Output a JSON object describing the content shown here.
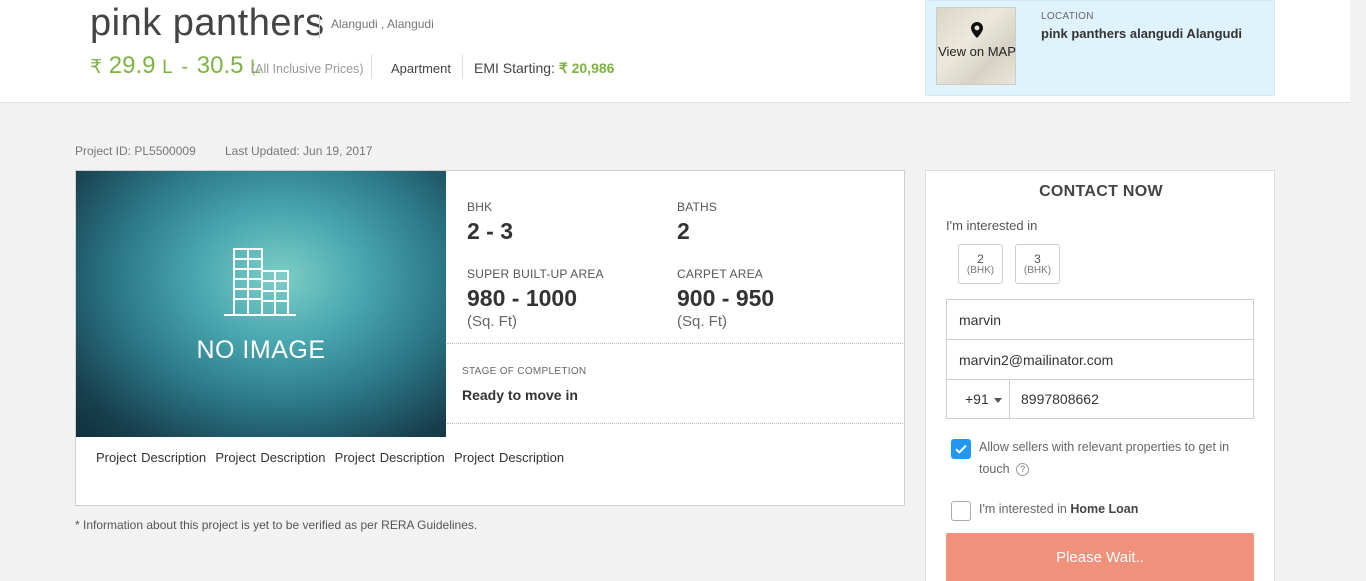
{
  "project": {
    "name": "pink panthers",
    "locality": "Alangudi , Alangudi",
    "price": {
      "currency": "₹",
      "min": "29.9",
      "max": "30.5",
      "unit": "L",
      "separator": "-",
      "note": "(All Inclusive Prices)"
    },
    "property_type": "Apartment",
    "emi": {
      "label": "EMI Starting:",
      "value": "₹ 20,986"
    },
    "id_text": "Project ID: PL5500009",
    "last_updated": "Last Updated: Jun 19, 2017"
  },
  "location": {
    "caption": "LOCATION",
    "text": "pink panthers alangudi Alangudi",
    "map_button": "View on MAP",
    "map_icon": "map-pin-icon"
  },
  "image": {
    "placeholder": "NO IMAGE",
    "icon": "building-icon"
  },
  "specs": {
    "bhk": {
      "label": "BHK",
      "value": "2 - 3"
    },
    "baths": {
      "label": "BATHS",
      "value": "2"
    },
    "super_area": {
      "label": "SUPER BUILT-UP AREA",
      "value": "980 - 1000",
      "unit": "(Sq. Ft)"
    },
    "carpet_area": {
      "label": "CARPET AREA",
      "value": "900 - 950",
      "unit": "(Sq. Ft)"
    },
    "stage": {
      "label": "STAGE OF COMPLETION",
      "value": "Ready to move in"
    }
  },
  "description": "Project Description  Project Description  Project Description  Project Description",
  "rera_note": "* Information about this project is yet to be verified as per RERA Guidelines.",
  "contact": {
    "title": "CONTACT NOW",
    "interest_label": "I'm interested in",
    "bhk_options": [
      {
        "num": "2",
        "sub": "(BHK)"
      },
      {
        "num": "3",
        "sub": "(BHK)"
      }
    ],
    "name_value": "marvin",
    "email_value": "marvin2@mailinator.com",
    "country_code": "+91",
    "phone_value": "8997808662",
    "allow_text": "Allow sellers with relevant properties to get in touch",
    "allow_checked": true,
    "help_icon_glyph": "?",
    "loan_prefix": "I'm interested in ",
    "loan_bold": "Home Loan",
    "loan_checked": false,
    "submit_label": "Please Wait.."
  },
  "colors": {
    "price_green": "#7cb342",
    "location_bg": "#dff3fc",
    "checkbox_blue": "#2196f3",
    "submit_bg": "#f0917b"
  }
}
